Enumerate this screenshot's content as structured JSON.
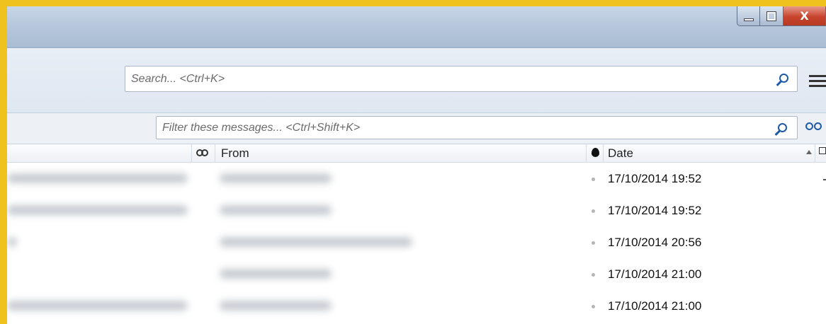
{
  "window": {
    "controls": {
      "minimize": "",
      "maximize": "",
      "close": "X"
    }
  },
  "toolbar": {
    "search_placeholder": "Search... <Ctrl+K>"
  },
  "filterbar": {
    "filter_placeholder": "Filter these messages... <Ctrl+Shift+K>"
  },
  "columns": {
    "from": "From",
    "date": "Date"
  },
  "messages": [
    {
      "date": "17/10/2014 19:52"
    },
    {
      "date": "17/10/2014 19:52"
    },
    {
      "date": "17/10/2014 20:56"
    },
    {
      "date": "17/10/2014 21:00"
    },
    {
      "date": "17/10/2014 21:00"
    }
  ],
  "colors": {
    "frame": "#f0c21d",
    "accent": "#1e5aa8",
    "close_button": "#c7442d"
  },
  "icons": [
    "minimize-icon",
    "maximize-icon",
    "close-icon",
    "search-icon",
    "menu-icon",
    "filter-search-icon",
    "quick-filter-icon",
    "read-status-icon",
    "junk-status-icon",
    "sort-ascending-icon",
    "column-picker-icon"
  ]
}
